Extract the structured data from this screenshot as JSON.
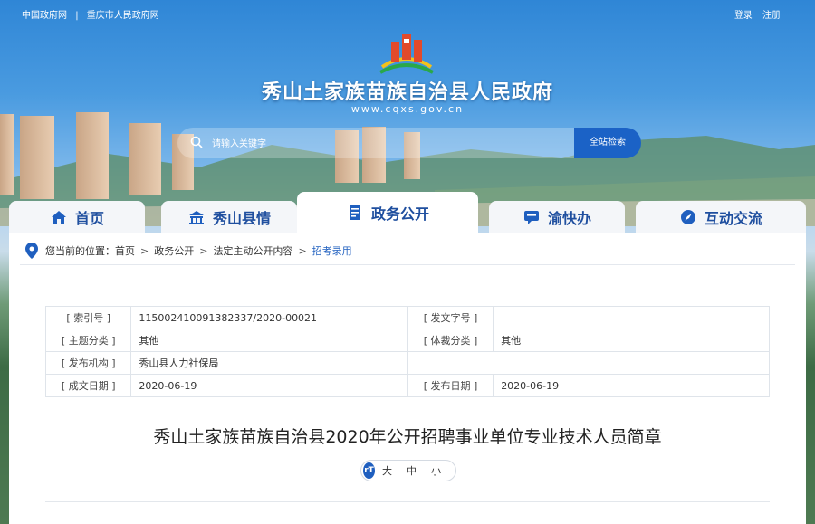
{
  "topbar": {
    "links": [
      "中国政府网",
      "|",
      "重庆市人民政府网"
    ],
    "login": "登录",
    "register": "注册"
  },
  "header": {
    "title": "秀山土家族苗族自治县人民政府",
    "url": "www.cqxs.gov.cn"
  },
  "search": {
    "placeholder": "请输入关键字",
    "button": "全站检索"
  },
  "nav": {
    "tabs": [
      {
        "label": "首页",
        "icon": "home-icon"
      },
      {
        "label": "秀山县情",
        "icon": "building-icon"
      },
      {
        "label": "政务公开",
        "icon": "document-icon",
        "active": true
      },
      {
        "label": "渝快办",
        "icon": "chat-icon"
      },
      {
        "label": "互动交流",
        "icon": "compass-icon"
      }
    ]
  },
  "breadcrumb": {
    "prefix": "您当前的位置：",
    "items": [
      "首页",
      "政务公开",
      "法定主动公开内容",
      "招考录用"
    ],
    "separator": ">"
  },
  "meta": {
    "index_label": "[ 索引号 ]",
    "index_value": "11500241009138​2337/2020-00021",
    "docno_label": "[ 发文字号 ]",
    "docno_value": "",
    "topic_label": "[ 主题分类 ]",
    "topic_value": "其他",
    "genre_label": "[ 体裁分类 ]",
    "genre_value": "其他",
    "org_label": "[ 发布机构 ]",
    "org_value": "秀山县人力社保局",
    "created_label": "[ 成文日期 ]",
    "created_value": "2020-06-19",
    "published_label": "[ 发布日期 ]",
    "published_value": "2020-06-19"
  },
  "article": {
    "title": "秀山土家族苗族自治县2020年公开招聘事业单位专业技术人员简章"
  },
  "font_size": {
    "icon_text": "rT",
    "large": "大",
    "medium": "中",
    "small": "小"
  },
  "colors": {
    "brand_blue": "#1f5fbf",
    "search_button": "#1b62c6",
    "nav_text": "#1f4f9f"
  }
}
